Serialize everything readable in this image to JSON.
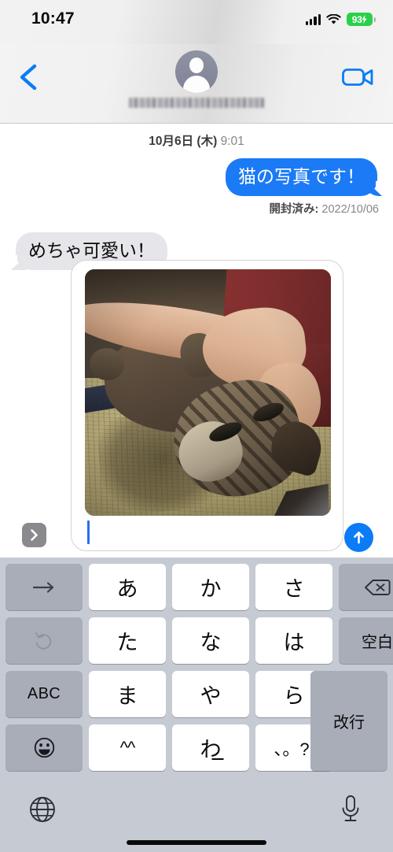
{
  "status_bar": {
    "time": "10:47",
    "signal_icon": "cellular-bars-icon",
    "wifi_icon": "wifi-icon",
    "battery_percent": "93",
    "battery_charging": true,
    "battery_color": "#2ad04a"
  },
  "nav_bar": {
    "back_icon": "back-chevron-icon",
    "contact_name": "",
    "contact_name_redacted": true,
    "avatar_icon": "person-avatar-icon",
    "facetime_icon": "video-camera-icon",
    "accent_color": "#0b7cf5"
  },
  "conversation": {
    "timestamp_date": "10月6日 (木)",
    "timestamp_time": "9:01",
    "messages": [
      {
        "direction": "outgoing",
        "text": "猫の写真です！",
        "bubble_color": "#1b7af5",
        "text_color": "#ffffff"
      },
      {
        "direction": "incoming",
        "text": "めちゃ可愛い！",
        "bubble_color": "#e6e5ea",
        "text_color": "#0a0a0a"
      }
    ],
    "read_receipt_label": "開封済み:",
    "read_receipt_date": "2022/10/06"
  },
  "input_bar": {
    "expand_icon": "chevron-right-icon",
    "attachment_type": "photo-attachment",
    "attachment_alt": "猫の写真",
    "text_value": "",
    "caret_visible": true,
    "send_icon": "send-arrow-up-icon",
    "send_color": "#0b7cf5"
  },
  "keyboard": {
    "type": "japanese-kana",
    "rows": [
      [
        {
          "label": "→",
          "name": "key-arrow-right",
          "style": "func",
          "icon": "arrow-right-icon"
        },
        {
          "label": "あ",
          "name": "key-a",
          "style": "letter"
        },
        {
          "label": "か",
          "name": "key-ka",
          "style": "letter"
        },
        {
          "label": "さ",
          "name": "key-sa",
          "style": "letter"
        },
        {
          "label": "",
          "name": "key-backspace",
          "style": "func",
          "icon": "backspace-icon"
        }
      ],
      [
        {
          "label": "",
          "name": "key-undo",
          "style": "func",
          "icon": "undo-arrow-icon"
        },
        {
          "label": "た",
          "name": "key-ta",
          "style": "letter"
        },
        {
          "label": "な",
          "name": "key-na",
          "style": "letter"
        },
        {
          "label": "は",
          "name": "key-ha",
          "style": "letter"
        },
        {
          "label": "空白",
          "name": "key-space",
          "style": "func"
        }
      ],
      [
        {
          "label": "ABC",
          "name": "key-abc",
          "style": "func"
        },
        {
          "label": "ま",
          "name": "key-ma",
          "style": "letter"
        },
        {
          "label": "や",
          "name": "key-ya",
          "style": "letter"
        },
        {
          "label": "ら",
          "name": "key-ra",
          "style": "letter"
        }
      ],
      [
        {
          "label": "",
          "name": "key-emoji",
          "style": "func",
          "icon": "emoji-smiley-icon"
        },
        {
          "label": "^^",
          "name": "key-kaomoji",
          "style": "letter"
        },
        {
          "label": "わ",
          "name": "key-wa",
          "style": "letter"
        },
        {
          "label": "、。?!",
          "name": "key-punctuation",
          "style": "letter"
        }
      ]
    ],
    "return_label": "改行",
    "globe_icon": "globe-icon",
    "mic_icon": "microphone-icon"
  }
}
